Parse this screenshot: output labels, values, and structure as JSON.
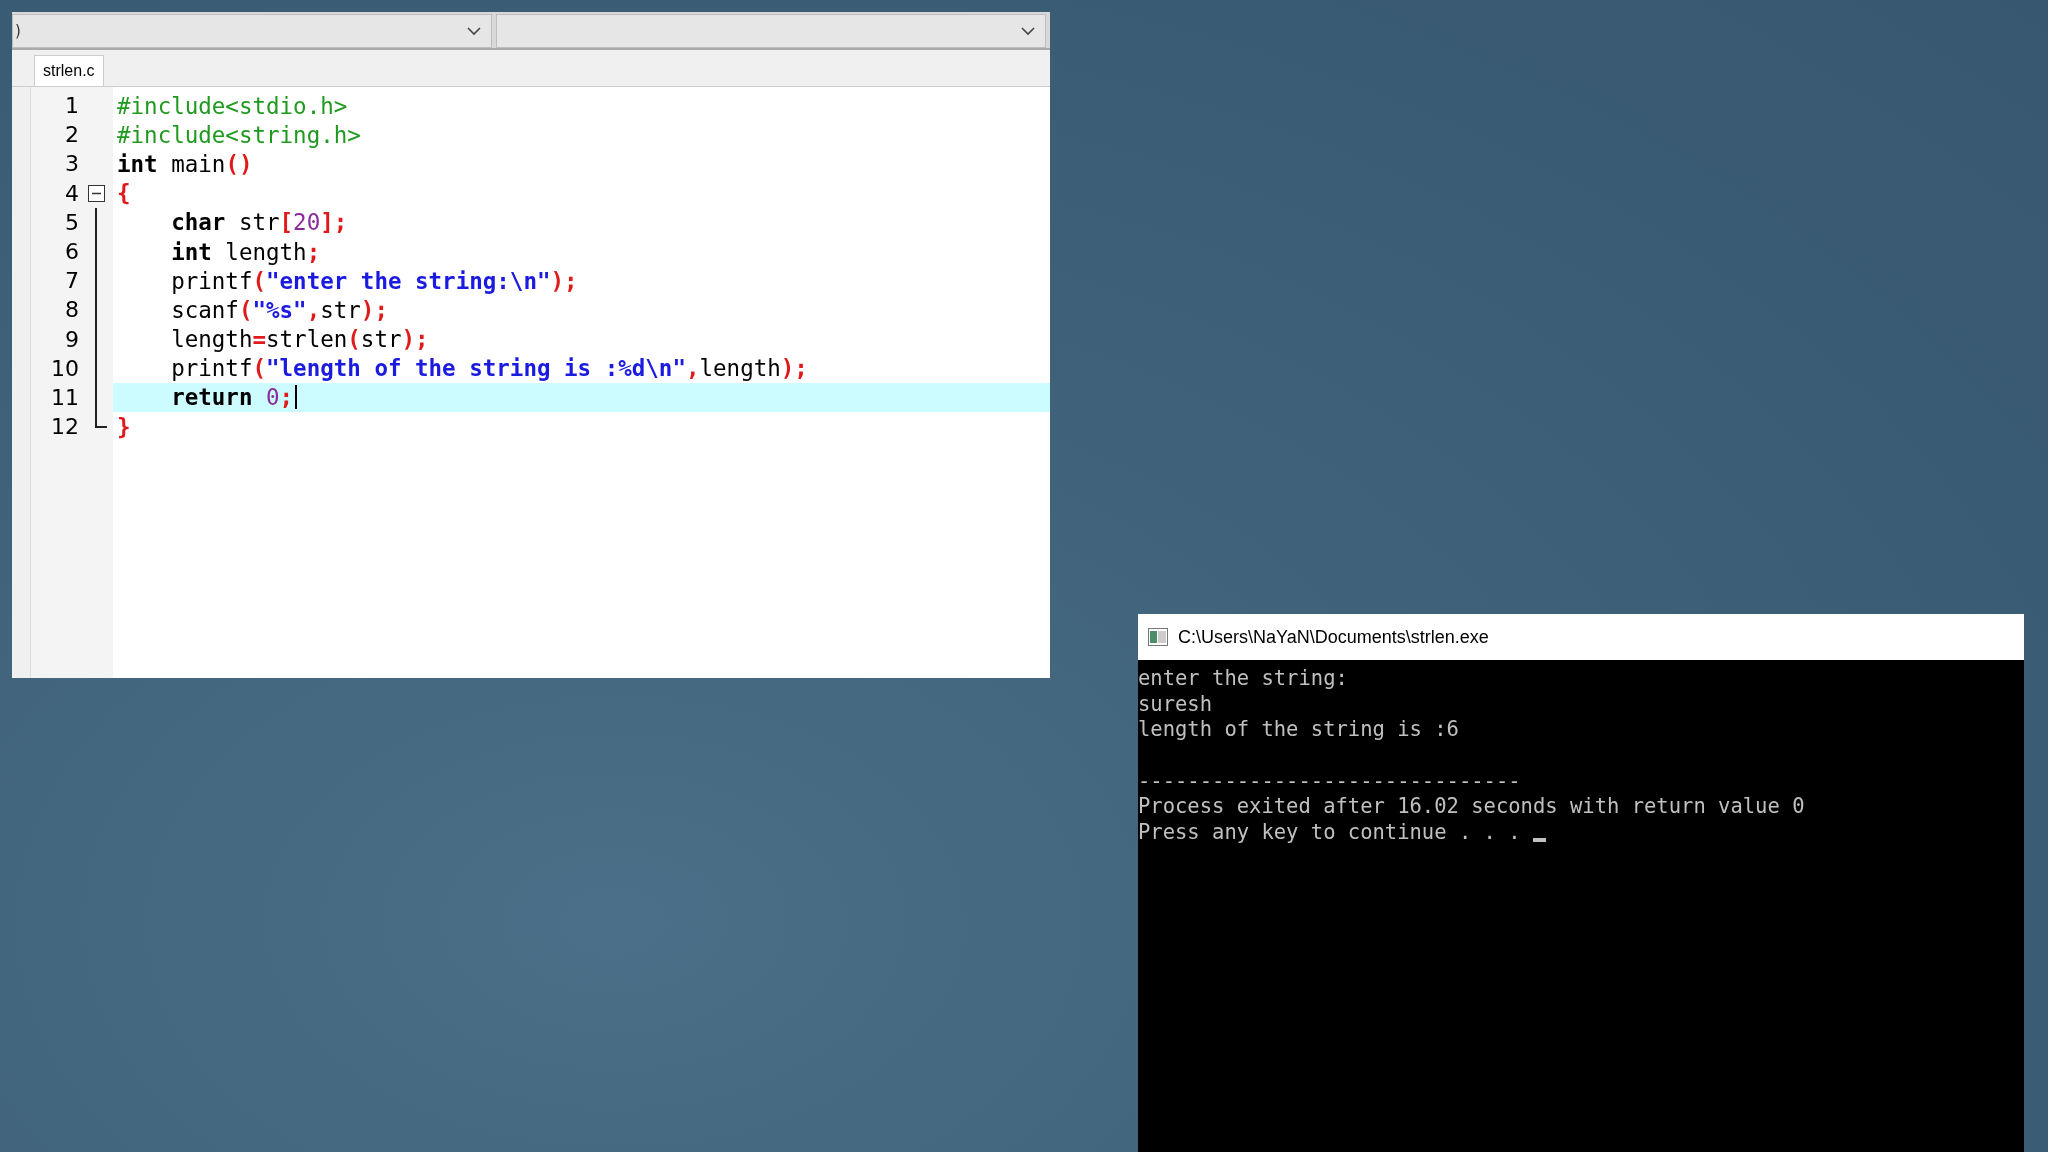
{
  "editor": {
    "combos": [
      {
        "kind": "dropdown",
        "text": ")"
      },
      {
        "kind": "dropdown"
      }
    ],
    "tabs": [
      {
        "label": "strlen.c",
        "selected": true
      }
    ],
    "lines": [
      {
        "number": "1",
        "kind": "plain",
        "current": false,
        "tokens": [
          {
            "kind": "pre",
            "text": "#include<stdio.h>"
          }
        ]
      },
      {
        "number": "2",
        "kind": "plain",
        "current": false,
        "tokens": [
          {
            "kind": "pre",
            "text": "#include<string.h>"
          }
        ]
      },
      {
        "number": "3",
        "kind": "plain",
        "current": false,
        "tokens": [
          {
            "kind": "kw",
            "text": "int"
          },
          {
            "kind": "plain",
            "text": " main"
          },
          {
            "kind": "punct",
            "text": "()"
          }
        ]
      },
      {
        "number": "4",
        "kind": "fold-start",
        "current": false,
        "tokens": [
          {
            "kind": "punct",
            "text": "{"
          }
        ]
      },
      {
        "number": "5",
        "kind": "fold-inside",
        "current": false,
        "tokens": [
          {
            "kind": "kw",
            "text": "    char"
          },
          {
            "kind": "plain",
            "text": " str"
          },
          {
            "kind": "punct",
            "text": "["
          },
          {
            "kind": "num",
            "text": "20"
          },
          {
            "kind": "punct",
            "text": "];"
          }
        ]
      },
      {
        "number": "6",
        "kind": "fold-inside",
        "current": false,
        "tokens": [
          {
            "kind": "kw",
            "text": "    int"
          },
          {
            "kind": "plain",
            "text": " length"
          },
          {
            "kind": "punct",
            "text": ";"
          }
        ]
      },
      {
        "number": "7",
        "kind": "fold-inside",
        "current": false,
        "tokens": [
          {
            "kind": "plain",
            "text": "    printf"
          },
          {
            "kind": "punct",
            "text": "("
          },
          {
            "kind": "str",
            "text": "\"enter the string:\\n\""
          },
          {
            "kind": "punct",
            "text": ");"
          }
        ]
      },
      {
        "number": "8",
        "kind": "fold-inside",
        "current": false,
        "tokens": [
          {
            "kind": "plain",
            "text": "    scanf"
          },
          {
            "kind": "punct",
            "text": "("
          },
          {
            "kind": "str",
            "text": "\"%s\""
          },
          {
            "kind": "punct",
            "text": ","
          },
          {
            "kind": "plain",
            "text": "str"
          },
          {
            "kind": "punct",
            "text": ");"
          }
        ]
      },
      {
        "number": "9",
        "kind": "fold-inside",
        "current": false,
        "tokens": [
          {
            "kind": "plain",
            "text": "    length"
          },
          {
            "kind": "punct",
            "text": "="
          },
          {
            "kind": "plain",
            "text": "strlen"
          },
          {
            "kind": "punct",
            "text": "("
          },
          {
            "kind": "plain",
            "text": "str"
          },
          {
            "kind": "punct",
            "text": ");"
          }
        ]
      },
      {
        "number": "10",
        "kind": "fold-inside",
        "current": false,
        "tokens": [
          {
            "kind": "plain",
            "text": "    printf"
          },
          {
            "kind": "punct",
            "text": "("
          },
          {
            "kind": "str",
            "text": "\"length of the string is :%d\\n\""
          },
          {
            "kind": "punct",
            "text": ","
          },
          {
            "kind": "plain",
            "text": "length"
          },
          {
            "kind": "punct",
            "text": ");"
          }
        ]
      },
      {
        "number": "11",
        "kind": "fold-inside",
        "current": true,
        "tokens": [
          {
            "kind": "kw",
            "text": "    return"
          },
          {
            "kind": "num",
            "text": " 0"
          },
          {
            "kind": "punct",
            "text": ";"
          }
        ]
      },
      {
        "number": "12",
        "kind": "fold-end",
        "current": false,
        "tokens": [
          {
            "kind": "punct",
            "text": "}"
          }
        ]
      }
    ]
  },
  "console": {
    "title": "C:\\Users\\NaYaN\\Documents\\strlen.exe",
    "output": [
      "enter the string:",
      "suresh",
      "length of the string is :6"
    ],
    "footer": [
      "-------------------------------",
      "Process exited after 16.02 seconds with return value 0",
      "Press any key to continue . . ."
    ]
  }
}
